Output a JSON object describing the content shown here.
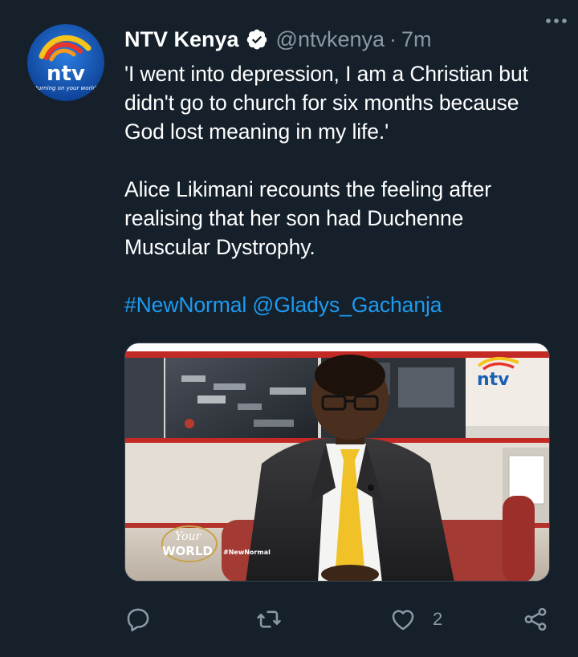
{
  "tweet": {
    "author_name": "NTV Kenya",
    "handle": "@ntvkenya",
    "separator": "·",
    "time": "7m",
    "avatar_logo_text": "ntv",
    "avatar_tagline": "turning on your world",
    "paragraph1": "'I went into depression, I am a Christian but\ndidn't go to church for six months because\nGod lost meaning in my life.'",
    "paragraph2": "Alice Likimani recounts the feeling after\nrealising that her son had Duchenne\nMuscular Dystrophy.",
    "hashtag": "#NewNormal",
    "mention": "@Gladys_Gachanja",
    "like_count": "2"
  },
  "media": {
    "program_logo_line1": "Your",
    "program_logo_line2": "WORLD",
    "program_hashtag": "#NewNormal",
    "channel_logo": "ntv"
  },
  "icons": {
    "verified": "verified-badge-icon",
    "more": "more-options-icon",
    "reply": "reply-icon",
    "retweet": "retweet-icon",
    "like": "heart-icon",
    "share": "share-icon"
  },
  "colors": {
    "background": "#15202b",
    "link": "#1d9bf0",
    "muted": "#8b98a5",
    "brand_blue": "#1a5fb4"
  }
}
